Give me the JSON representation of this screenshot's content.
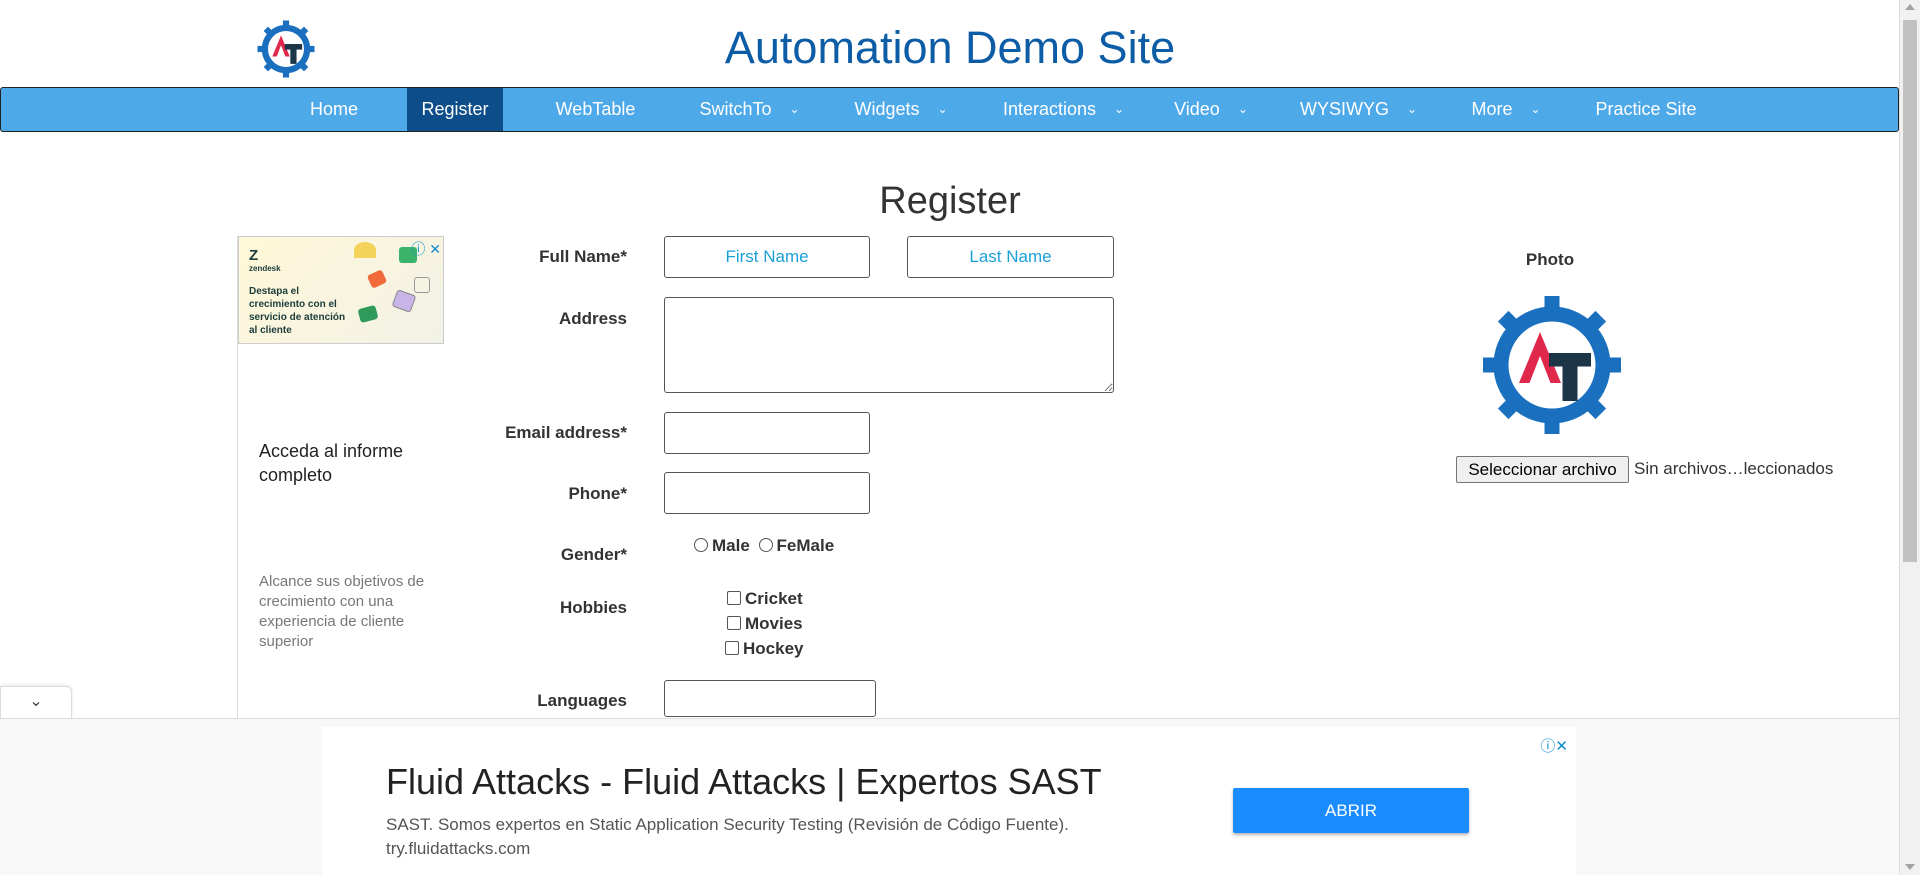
{
  "site": {
    "title": "Automation Demo Site"
  },
  "nav": {
    "items": [
      {
        "label": "Home"
      },
      {
        "label": "Register"
      },
      {
        "label": "WebTable"
      },
      {
        "label": "SwitchTo"
      },
      {
        "label": "Widgets"
      },
      {
        "label": "Interactions"
      },
      {
        "label": "Video"
      },
      {
        "label": "WYSIWYG"
      },
      {
        "label": "More"
      },
      {
        "label": "Practice Site"
      }
    ],
    "active": "Register",
    "accent": "#4ea9e9",
    "active_color": "#0d4d8a"
  },
  "page": {
    "heading": "Register"
  },
  "form": {
    "full_name_label": "Full Name*",
    "first_name_placeholder": "First Name",
    "last_name_placeholder": "Last Name",
    "address_label": "Address",
    "email_label": "Email address*",
    "phone_label": "Phone*",
    "gender_label": "Gender*",
    "gender_options": [
      "Male",
      "FeMale"
    ],
    "hobbies_label": "Hobbies",
    "hobbies": [
      "Cricket",
      "Movies",
      "Hockey"
    ],
    "languages_label": "Languages"
  },
  "photo": {
    "label": "Photo",
    "button": "Seleccionar archivo",
    "status": "Sin archivos…leccionados"
  },
  "ad_left": {
    "brand": "zendesk",
    "banner_text": "Destapa el crecimiento con el servicio de atención al cliente",
    "headline": "Acceda al informe completo",
    "body": "Alcance sus objetivos de crecimiento con una experiencia de cliente superior"
  },
  "ad_bottom": {
    "title": "Fluid Attacks - Fluid Attacks | Expertos SAST",
    "description": "SAST. Somos expertos en Static Application Security Testing (Revisión de Código Fuente).",
    "url": "try.fluidattacks.com",
    "cta": "ABRIR",
    "cta_color": "#1a8cff"
  }
}
